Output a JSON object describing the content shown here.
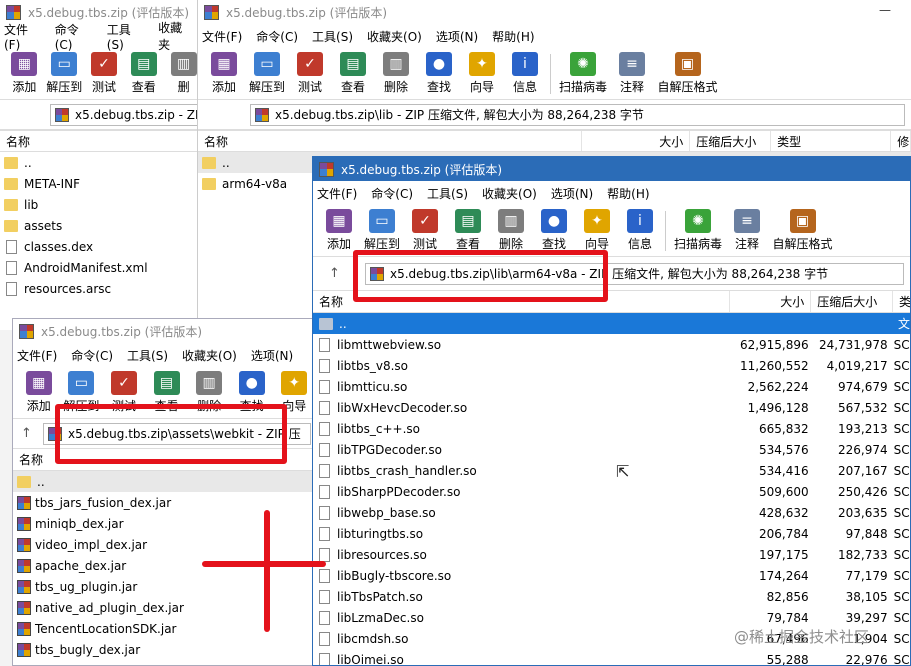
{
  "window_back": {
    "title": "x5.debug.tbs.zip (评估版本)",
    "menu": [
      "文件(F)",
      "命令(C)",
      "工具(S)",
      "收藏夹"
    ],
    "tools": [
      {
        "label": "添加",
        "icon": "add-archive-icon",
        "color": "#7a4b9c"
      },
      {
        "label": "解压到",
        "icon": "extract-folder-icon",
        "color": "#3d7fd1"
      },
      {
        "label": "测试",
        "icon": "test-clipboard-icon",
        "color": "#c0392b"
      },
      {
        "label": "查看",
        "icon": "view-book-icon",
        "color": "#2e8b57"
      },
      {
        "label": "删",
        "icon": "delete-bin-icon",
        "color": "#7d7d7d"
      }
    ],
    "address": "x5.debug.tbs.zip - ZI",
    "header_name": "名称",
    "items": [
      {
        "name": "..",
        "type": "folder"
      },
      {
        "name": "META-INF",
        "type": "folder"
      },
      {
        "name": "lib",
        "type": "folder"
      },
      {
        "name": "assets",
        "type": "folder"
      },
      {
        "name": "classes.dex",
        "type": "file"
      },
      {
        "name": "AndroidManifest.xml",
        "type": "file"
      },
      {
        "name": "resources.arsc",
        "type": "file"
      }
    ]
  },
  "window_lib": {
    "title": "x5.debug.tbs.zip (评估版本)",
    "menu": [
      "文件(F)",
      "命令(C)",
      "工具(S)",
      "收藏夹(O)",
      "选项(N)",
      "帮助(H)"
    ],
    "tools": [
      {
        "label": "添加",
        "icon": "add-archive-icon",
        "color": "#7a4b9c"
      },
      {
        "label": "解压到",
        "icon": "extract-folder-icon",
        "color": "#3d7fd1"
      },
      {
        "label": "测试",
        "icon": "test-clipboard-icon",
        "color": "#c0392b"
      },
      {
        "label": "查看",
        "icon": "view-book-icon",
        "color": "#2e8b57"
      },
      {
        "label": "删除",
        "icon": "delete-bin-icon",
        "color": "#7d7d7d"
      },
      {
        "label": "查找",
        "icon": "find-magnifier-icon",
        "color": "#2a63c9"
      },
      {
        "label": "向导",
        "icon": "wizard-wand-icon",
        "color": "#e0a500"
      },
      {
        "label": "信息",
        "icon": "info-icon",
        "color": "#2a63c9"
      },
      {
        "label": "扫描病毒",
        "icon": "scan-virus-icon",
        "color": "#3aa33a"
      },
      {
        "label": "注释",
        "icon": "comment-icon",
        "color": "#6a7fa0"
      },
      {
        "label": "自解压格式",
        "icon": "sfx-archive-icon",
        "color": "#b5651d"
      }
    ],
    "address": "x5.debug.tbs.zip\\lib - ZIP 压缩文件, 解包大小为 88,264,238 字节",
    "headers": [
      "名称",
      "大小",
      "压缩后大小",
      "类型",
      "修"
    ],
    "items": [
      {
        "name": "..",
        "type": "folder"
      },
      {
        "name": "arm64-v8a",
        "type": "folder"
      }
    ]
  },
  "window_arm": {
    "title": "x5.debug.tbs.zip (评估版本)",
    "menu": [
      "文件(F)",
      "命令(C)",
      "工具(S)",
      "收藏夹(O)",
      "选项(N)",
      "帮助(H)"
    ],
    "tools": [
      {
        "label": "添加",
        "icon": "add-archive-icon",
        "color": "#7a4b9c"
      },
      {
        "label": "解压到",
        "icon": "extract-folder-icon",
        "color": "#3d7fd1"
      },
      {
        "label": "测试",
        "icon": "test-clipboard-icon",
        "color": "#c0392b"
      },
      {
        "label": "查看",
        "icon": "view-book-icon",
        "color": "#2e8b57"
      },
      {
        "label": "删除",
        "icon": "delete-bin-icon",
        "color": "#7d7d7d"
      },
      {
        "label": "查找",
        "icon": "find-magnifier-icon",
        "color": "#2a63c9"
      },
      {
        "label": "向导",
        "icon": "wizard-wand-icon",
        "color": "#e0a500"
      },
      {
        "label": "信息",
        "icon": "info-icon",
        "color": "#2a63c9"
      },
      {
        "label": "扫描病毒",
        "icon": "scan-virus-icon",
        "color": "#3aa33a"
      },
      {
        "label": "注释",
        "icon": "comment-icon",
        "color": "#6a7fa0"
      },
      {
        "label": "自解压格式",
        "icon": "sfx-archive-icon",
        "color": "#b5651d"
      }
    ],
    "address": "x5.debug.tbs.zip\\lib\\arm64-v8a - ZIP 压缩文件, 解包大小为 88,264,238 字节",
    "headers": [
      "名称",
      "大小",
      "压缩后大小",
      "类"
    ],
    "parent_row": {
      "name": "..",
      "type_suffix": "文"
    },
    "files": [
      {
        "name": "libmttwebview.so",
        "size": "62,915,896",
        "packed": "24,731,978",
        "type": "SC"
      },
      {
        "name": "libtbs_v8.so",
        "size": "11,260,552",
        "packed": "4,019,217",
        "type": "SC"
      },
      {
        "name": "libmtticu.so",
        "size": "2,562,224",
        "packed": "974,679",
        "type": "SC"
      },
      {
        "name": "libWxHevcDecoder.so",
        "size": "1,496,128",
        "packed": "567,532",
        "type": "SC"
      },
      {
        "name": "libtbs_c++.so",
        "size": "665,832",
        "packed": "193,213",
        "type": "SC"
      },
      {
        "name": "libTPGDecoder.so",
        "size": "534,576",
        "packed": "226,974",
        "type": "SC"
      },
      {
        "name": "libtbs_crash_handler.so",
        "size": "534,416",
        "packed": "207,167",
        "type": "SC"
      },
      {
        "name": "libSharpPDecoder.so",
        "size": "509,600",
        "packed": "250,426",
        "type": "SC"
      },
      {
        "name": "libwebp_base.so",
        "size": "428,632",
        "packed": "203,635",
        "type": "SC"
      },
      {
        "name": "libturingtbs.so",
        "size": "206,784",
        "packed": "97,848",
        "type": "SC"
      },
      {
        "name": "libresources.so",
        "size": "197,175",
        "packed": "182,733",
        "type": "SC"
      },
      {
        "name": "libBugly-tbscore.so",
        "size": "174,264",
        "packed": "77,179",
        "type": "SC"
      },
      {
        "name": "libTbsPatch.so",
        "size": "82,856",
        "packed": "38,105",
        "type": "SC"
      },
      {
        "name": "libLzmaDec.so",
        "size": "79,784",
        "packed": "39,297",
        "type": "SC"
      },
      {
        "name": "libcmdsh.so",
        "size": "67,496",
        "packed": "1,904",
        "type": "SC"
      },
      {
        "name": "libOimei.so",
        "size": "55,288",
        "packed": "22,976",
        "type": "SC"
      }
    ]
  },
  "window_webkit": {
    "title": "x5.debug.tbs.zip (评估版本)",
    "menu": [
      "文件(F)",
      "命令(C)",
      "工具(S)",
      "收藏夹(O)",
      "选项(N)"
    ],
    "tools": [
      {
        "label": "添加",
        "icon": "add-archive-icon",
        "color": "#7a4b9c"
      },
      {
        "label": "解压到",
        "icon": "extract-folder-icon",
        "color": "#3d7fd1"
      },
      {
        "label": "测试",
        "icon": "test-clipboard-icon",
        "color": "#c0392b"
      },
      {
        "label": "查看",
        "icon": "view-book-icon",
        "color": "#2e8b57"
      },
      {
        "label": "删除",
        "icon": "delete-bin-icon",
        "color": "#7d7d7d"
      },
      {
        "label": "查找",
        "icon": "find-magnifier-icon",
        "color": "#2a63c9"
      },
      {
        "label": "向导",
        "icon": "wizard-wand-icon",
        "color": "#e0a500"
      }
    ],
    "address": "x5.debug.tbs.zip\\assets\\webkit - ZIP 压",
    "header_name": "名称",
    "items": [
      {
        "name": "..",
        "type": "folder"
      },
      {
        "name": "tbs_jars_fusion_dex.jar",
        "type": "jar"
      },
      {
        "name": "miniqb_dex.jar",
        "type": "jar"
      },
      {
        "name": "video_impl_dex.jar",
        "type": "jar"
      },
      {
        "name": "apache_dex.jar",
        "type": "jar"
      },
      {
        "name": "tbs_ug_plugin.jar",
        "type": "jar"
      },
      {
        "name": "native_ad_plugin_dex.jar",
        "type": "jar"
      },
      {
        "name": "TencentLocationSDK.jar",
        "type": "jar"
      },
      {
        "name": "tbs_bugly_dex.jar",
        "type": "jar"
      }
    ]
  },
  "window_controls": {
    "minimize": "—"
  },
  "watermark": "@稀土掘金技术社区",
  "colors": {
    "annotation_red": "#e4121b",
    "selection_blue": "#1a78d8",
    "active_title": "#2b6cb7"
  }
}
